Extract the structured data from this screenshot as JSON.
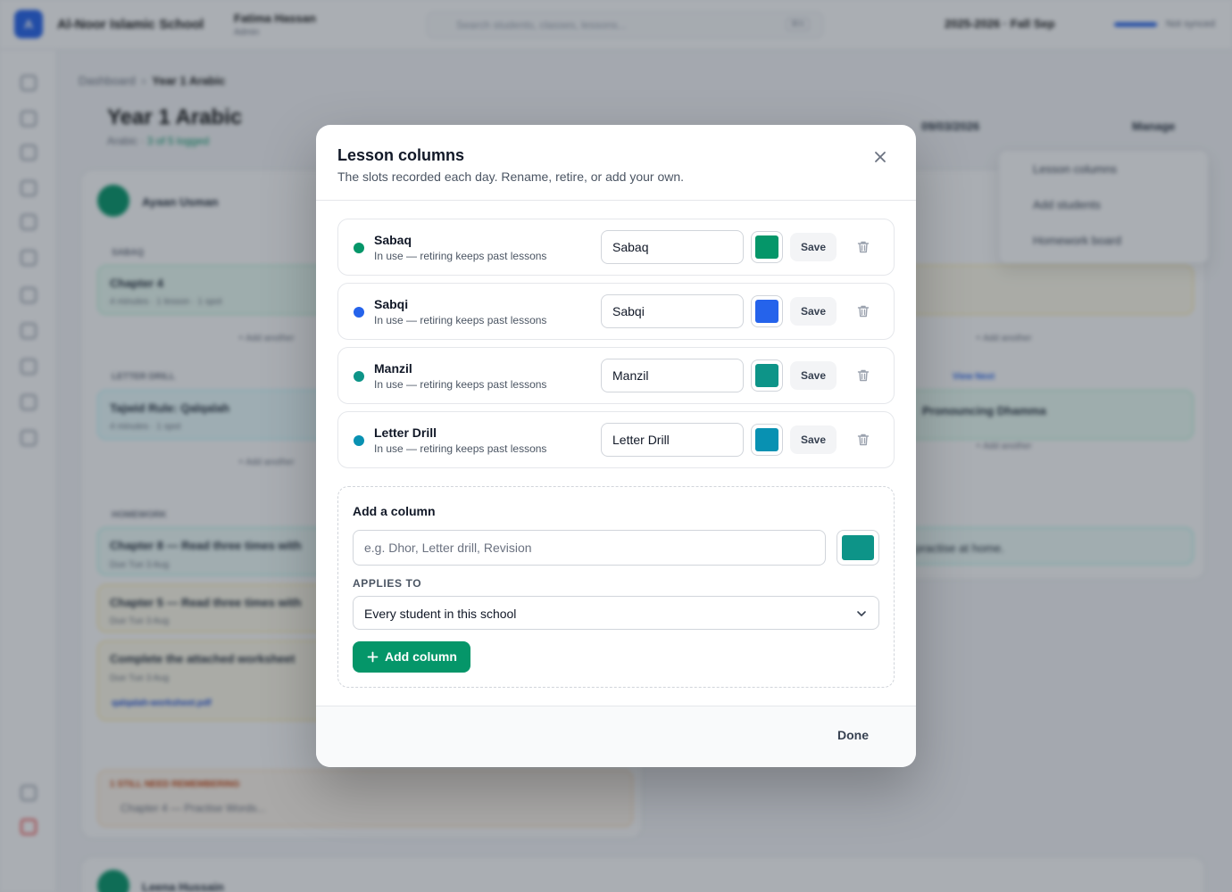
{
  "app": {
    "school_name": "Al-Noor Islamic School",
    "user_name": "Fatima Hassan",
    "user_role": "Admin",
    "search_placeholder": "Search students, classes, lessons...",
    "search_shortcut": "⌘K",
    "term": "2025-2026 · Fall Sep",
    "sync_status": "Not synced"
  },
  "page": {
    "breadcrumb_root": "Dashboard",
    "breadcrumb_current": "Year 1 Arabic",
    "title": "Year 1 Arabic",
    "subtitle_prefix": "Arabic ·",
    "subtitle_status": "3 of 5 logged",
    "date": "09/03/2026",
    "manage_label": "Manage"
  },
  "background": {
    "student_1": "Ayaan Usman",
    "student_2": "Leena Hussain",
    "section_sabaq": "SABAQ",
    "section_letter": "LETTER DRILL",
    "section_homework": "HOMEWORK",
    "section_overdue": "1 STILL NEED REMEMBERING",
    "chapter_4": "Chapter 4",
    "chapter_4_meta": "4 minutes · 1 lesson · 1 spot",
    "tajwid": "Tajwid Rule: Qalqalah",
    "tajwid_meta": "4 minutes · 1 spot",
    "add_another": "+ Add another",
    "hw_1": "Chapter 8 — Read three times with",
    "hw_2": "Chapter 5 — Read three times with",
    "hw_3": "Complete the attached worksheet",
    "hw_meta": "Due Tue 3 Aug",
    "attachment": "qalqalah-worksheet.pdf",
    "overdue_item": "Chapter 4 — Practise Words...",
    "right_chip_text": "Pronouncing Dhamma",
    "right_hw": "practise at home.",
    "view_next": "View Next"
  },
  "menu": {
    "items": [
      "Lesson columns",
      "Add students",
      "Homework board"
    ]
  },
  "modal": {
    "title": "Lesson columns",
    "subtitle": "The slots recorded each day. Rename, retire, or add your own.",
    "columns": [
      {
        "name": "Sabaq",
        "note": "In use — retiring keeps past lessons",
        "value": "Sabaq",
        "color": "#059669",
        "save_label": "Save"
      },
      {
        "name": "Sabqi",
        "note": "In use — retiring keeps past lessons",
        "value": "Sabqi",
        "color": "#2563eb",
        "save_label": "Save"
      },
      {
        "name": "Manzil",
        "note": "In use — retiring keeps past lessons",
        "value": "Manzil",
        "color": "#0d9488",
        "save_label": "Save"
      },
      {
        "name": "Letter Drill",
        "note": "In use — retiring keeps past lessons",
        "value": "Letter Drill",
        "color": "#0891b2",
        "save_label": "Save"
      }
    ],
    "add": {
      "title": "Add a column",
      "placeholder": "e.g. Dhor, Letter drill, Revision",
      "color": "#0d9488",
      "applies_label": "Applies to",
      "applies_value": "Every student in this school",
      "button_label": "Add column"
    },
    "done_label": "Done"
  },
  "colors": {
    "accent": "#059669",
    "overlay": "rgba(31,41,55,0.38)"
  }
}
